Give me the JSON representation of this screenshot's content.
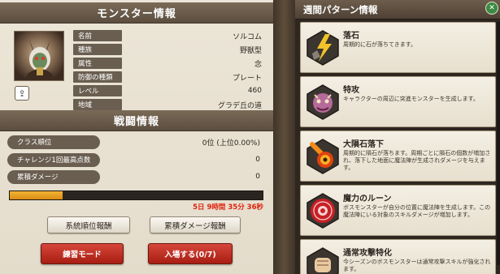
{
  "left": {
    "monster_header": "モンスター情報",
    "battle_header": "戦闘情報",
    "info": [
      {
        "label": "名前",
        "value": "ソルコム"
      },
      {
        "label": "種族",
        "value": "野獣型"
      },
      {
        "label": "属性",
        "value": "念"
      },
      {
        "label": "防御の種類",
        "value": "プレート"
      },
      {
        "label": "レベル",
        "value": "460"
      },
      {
        "label": "地域",
        "value": "グラデ丘の道"
      }
    ],
    "stats": [
      {
        "label": "クラス順位",
        "value": "0位 (上位0.00%)"
      },
      {
        "label": "チャレンジ1回最高点数",
        "value": "0"
      },
      {
        "label": "累積ダメージ",
        "value": "0"
      }
    ],
    "progress": 0.21,
    "timer": "5日 9時間 35分 36秒",
    "buttons": {
      "class_rank_reward": "系統順位報酬",
      "cumulative_damage_reward": "累積ダメージ報酬",
      "practice_mode": "練習モード",
      "enter": "入場する(0/7)"
    }
  },
  "right": {
    "header": "週間パターン情報",
    "cards": [
      {
        "title": "落石",
        "desc": "周期的に石が落ちてきます。"
      },
      {
        "title": "特攻",
        "desc": "キャラクターの周辺に突進モンスターを生成します。"
      },
      {
        "title": "大隕石落下",
        "desc": "周期的に隕石が落ちます。周期ごとに隕石の個数が増加され、落下した地面に魔法陣が生成されダメージを与えます。"
      },
      {
        "title": "魔力のルーン",
        "desc": "ボスモンスターが自分の位置に魔法陣を生成します。この魔法陣にいる対象のスキルダメージが増加します。"
      },
      {
        "title": "通常攻撃特化",
        "desc": "今シーズンのボスモンスターは通常攻撃スキルが強化されます。"
      }
    ]
  },
  "colors": {
    "timer": "#e0220d",
    "progress": "#e8a020",
    "red_button": "#b8281b"
  }
}
